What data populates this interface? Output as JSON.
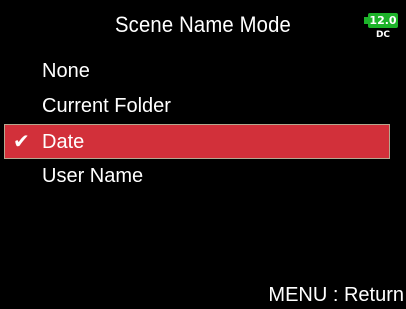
{
  "screen": {
    "title": "Scene Name Mode",
    "battery": {
      "level": "12.0",
      "source": "DC",
      "color": "#1db32a"
    },
    "options": [
      {
        "label": "None",
        "selected": false
      },
      {
        "label": "Current Folder",
        "selected": false
      },
      {
        "label": "Date",
        "selected": true
      },
      {
        "label": "User Name",
        "selected": false
      }
    ],
    "selected_check": "✔",
    "footer": "MENU : Return"
  },
  "colors": {
    "background": "#000000",
    "highlight": "#d2303a",
    "text": "#ffffff"
  }
}
